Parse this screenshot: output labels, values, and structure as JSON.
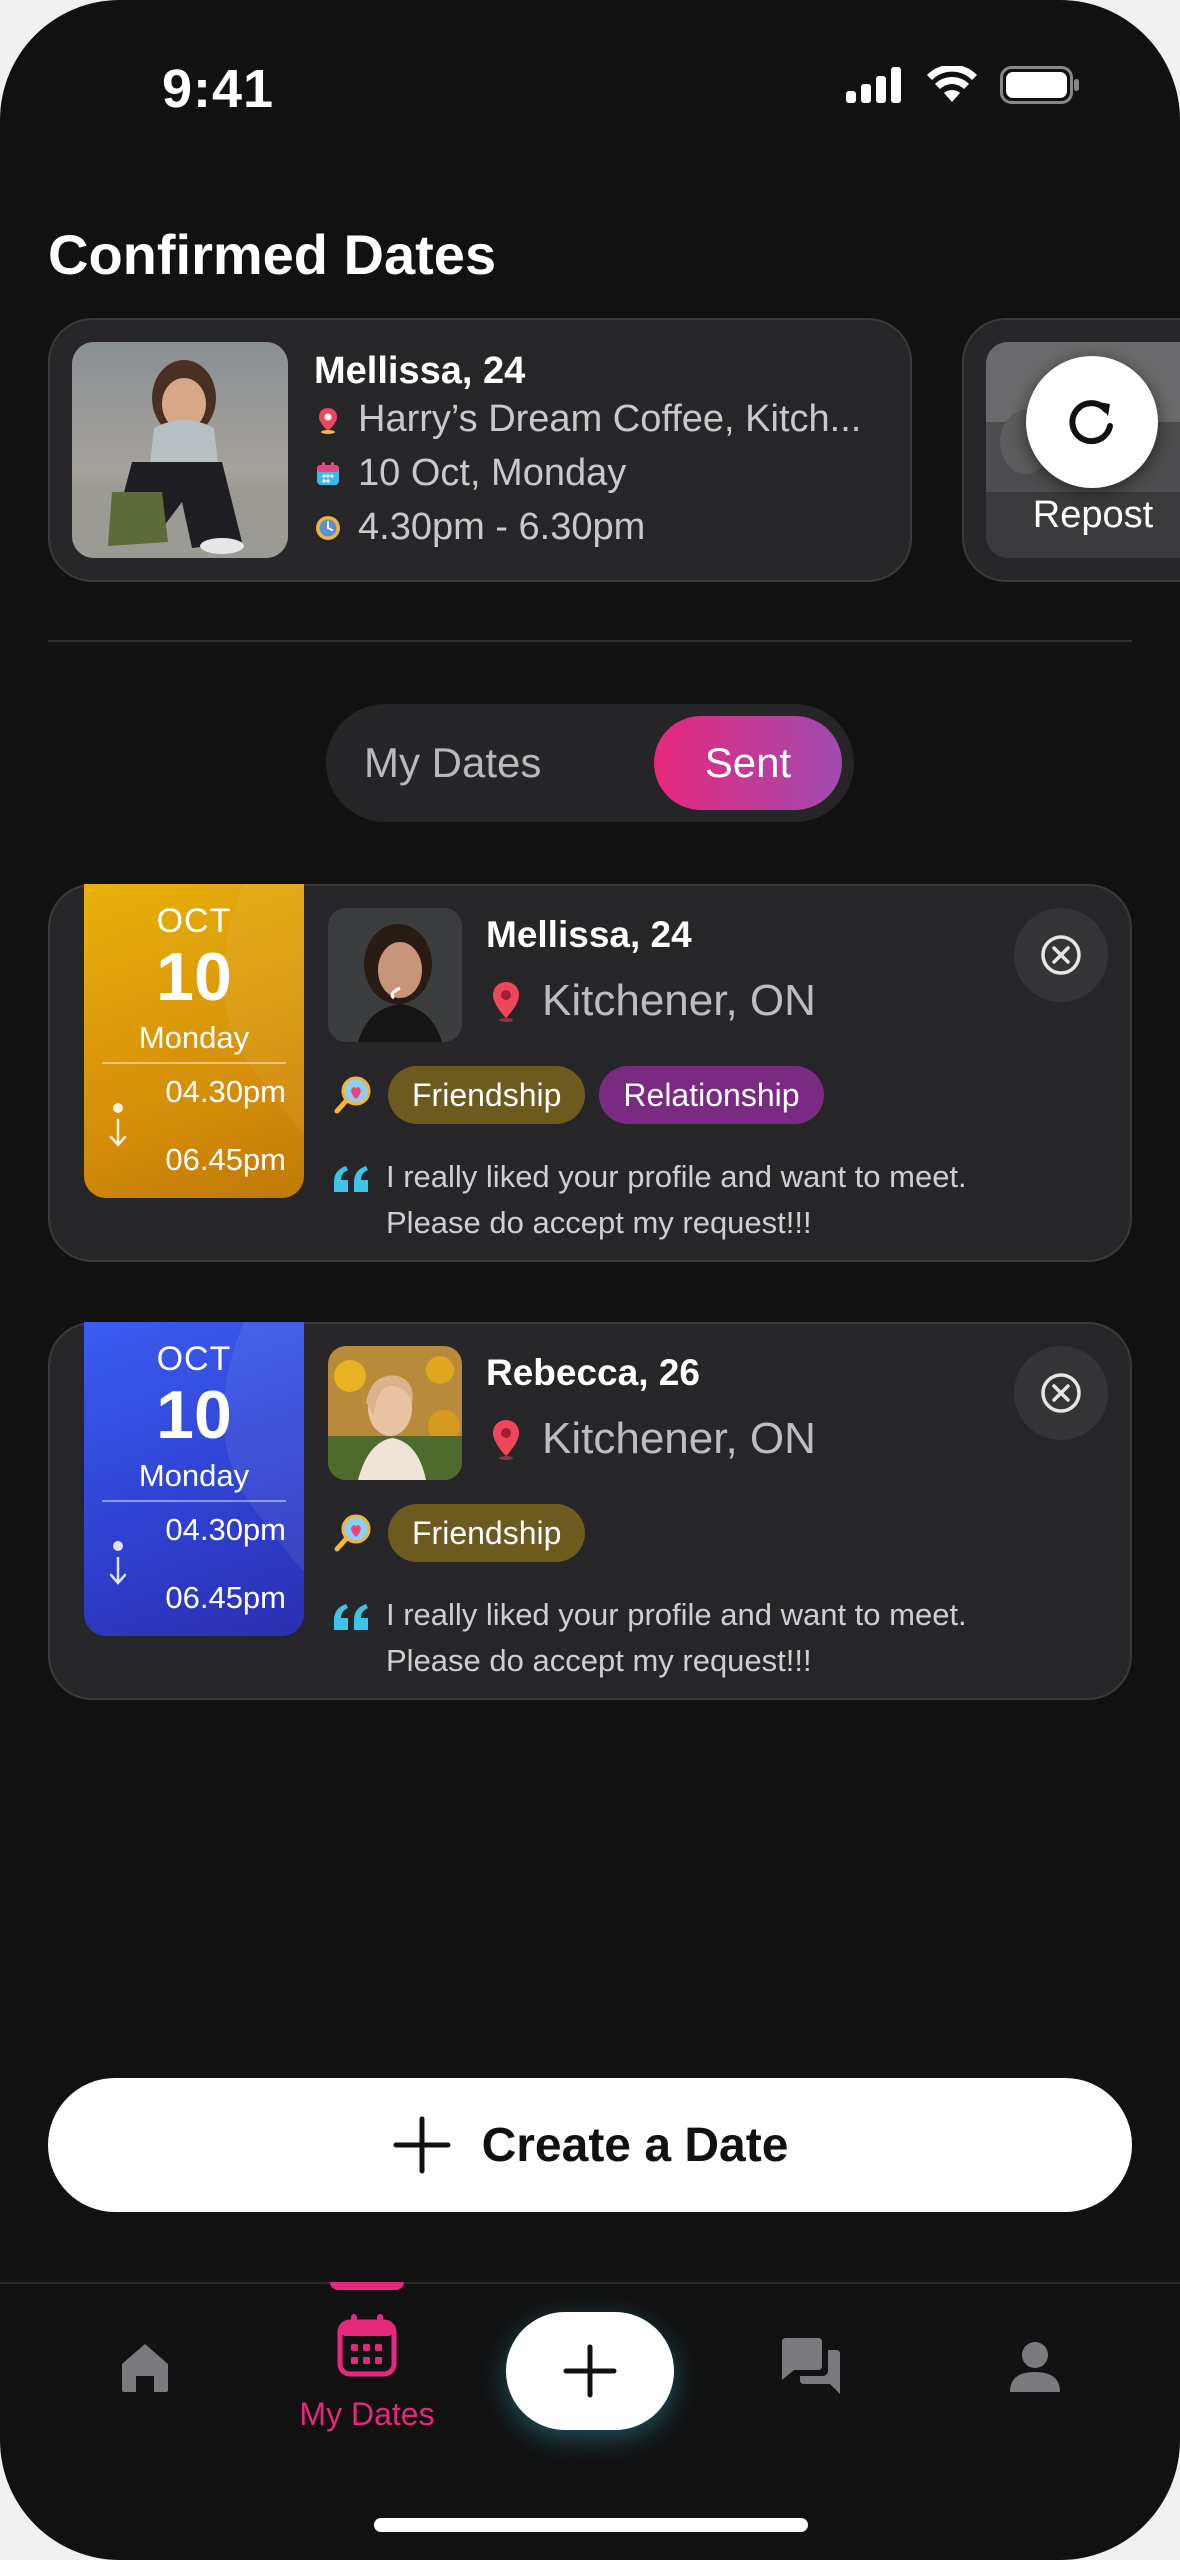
{
  "status_bar": {
    "time": "9:41"
  },
  "header": {
    "title": "Confirmed Dates"
  },
  "confirmed": {
    "name": "Mellissa, 24",
    "place": "Harry’s Dream Coffee, Kitch...",
    "date": "10 Oct, Monday",
    "time": "4.30pm - 6.30pm",
    "repost_label": "Repost"
  },
  "segment": {
    "my_dates": "My Dates",
    "sent": "Sent",
    "selected": "Sent"
  },
  "requests": [
    {
      "month": "OCT",
      "day": "10",
      "weekday": "Monday",
      "start": "04.30pm",
      "end": "06.45pm",
      "name": "Mellissa, 24",
      "location": "Kitchener, ON",
      "tags": [
        "Friendship",
        "Relationship"
      ],
      "message": "I really liked your profile and want to meet. Please do accept my request!!!",
      "tile_color": "#e0a00a"
    },
    {
      "month": "OCT",
      "day": "10",
      "weekday": "Monday",
      "start": "04.30pm",
      "end": "06.45pm",
      "name": "Rebecca, 26",
      "location": "Kitchener, ON",
      "tags": [
        "Friendship"
      ],
      "message": "I really liked your profile and want to meet. Please do accept my request!!!",
      "tile_color": "#3346d8"
    }
  ],
  "create_button": {
    "label": "Create a Date"
  },
  "bottom_nav": {
    "items": [
      {
        "name": "home",
        "icon": "home-icon"
      },
      {
        "name": "my-dates",
        "icon": "calendar-icon",
        "label": "My Dates",
        "active": true
      },
      {
        "name": "add",
        "icon": "plus-icon"
      },
      {
        "name": "chats",
        "icon": "chat-icon"
      },
      {
        "name": "profile",
        "icon": "profile-icon"
      }
    ]
  },
  "colors": {
    "accent": "#e6287c",
    "background": "#111112",
    "card": "#262628"
  }
}
